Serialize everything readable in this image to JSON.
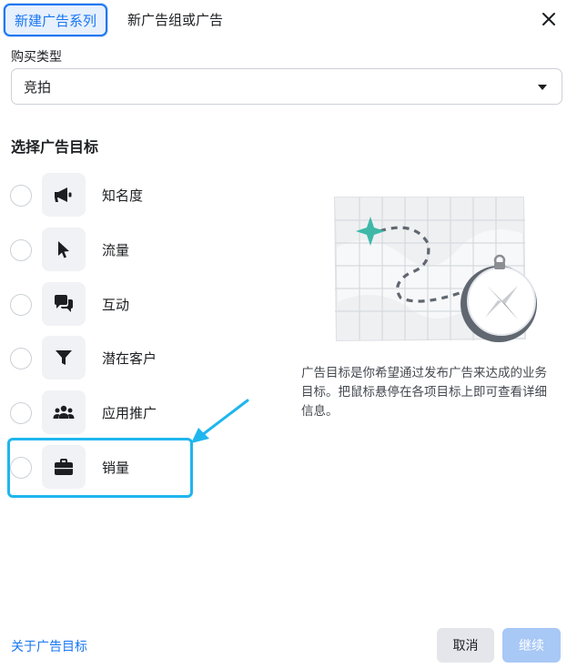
{
  "tabs": {
    "active": "新建广告系列",
    "inactive": "新广告组或广告"
  },
  "buy_type": {
    "label": "购买类型",
    "value": "竞拍"
  },
  "objectives": {
    "title": "选择广告目标",
    "items": [
      {
        "label": "知名度",
        "icon": "megaphone-icon"
      },
      {
        "label": "流量",
        "icon": "cursor-icon"
      },
      {
        "label": "互动",
        "icon": "chat-bubbles-icon"
      },
      {
        "label": "潜在客户",
        "icon": "funnel-icon"
      },
      {
        "label": "应用推广",
        "icon": "people-icon"
      },
      {
        "label": "销量",
        "icon": "briefcase-icon"
      }
    ]
  },
  "description": "广告目标是你希望通过发布广告来达成的业务目标。把鼠标悬停在各项目标上即可查看详细信息。",
  "footer": {
    "link": "关于广告目标",
    "cancel": "取消",
    "continue": "继续"
  },
  "colors": {
    "accent": "#1877f2",
    "highlight": "#1fb6ee",
    "continue_disabled": "#a8c8f6"
  }
}
